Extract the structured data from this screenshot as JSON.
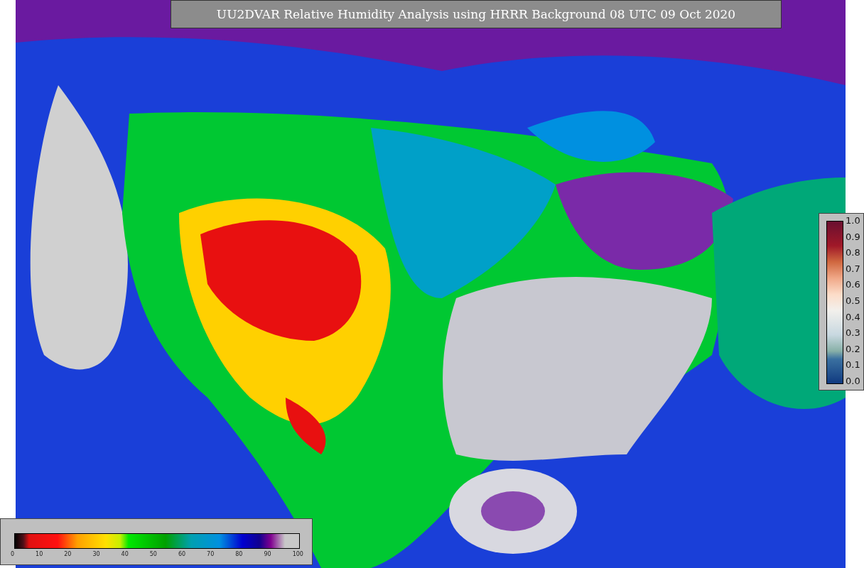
{
  "title": "UU2DVAR Relative Humidity Analysis using HRRR Background 08 UTC 09 Oct 2020",
  "observation_colorbar": {
    "ticks": [
      "1.0",
      "0.9",
      "0.8",
      "0.7",
      "0.6",
      "0.5",
      "0.4",
      "0.3",
      "0.2",
      "0.1",
      "0.0"
    ]
  },
  "humidity_colorbar": {
    "ticks": [
      "0",
      "10",
      "20",
      "30",
      "40",
      "50",
      "60",
      "70",
      "80",
      "90",
      "100"
    ]
  }
}
